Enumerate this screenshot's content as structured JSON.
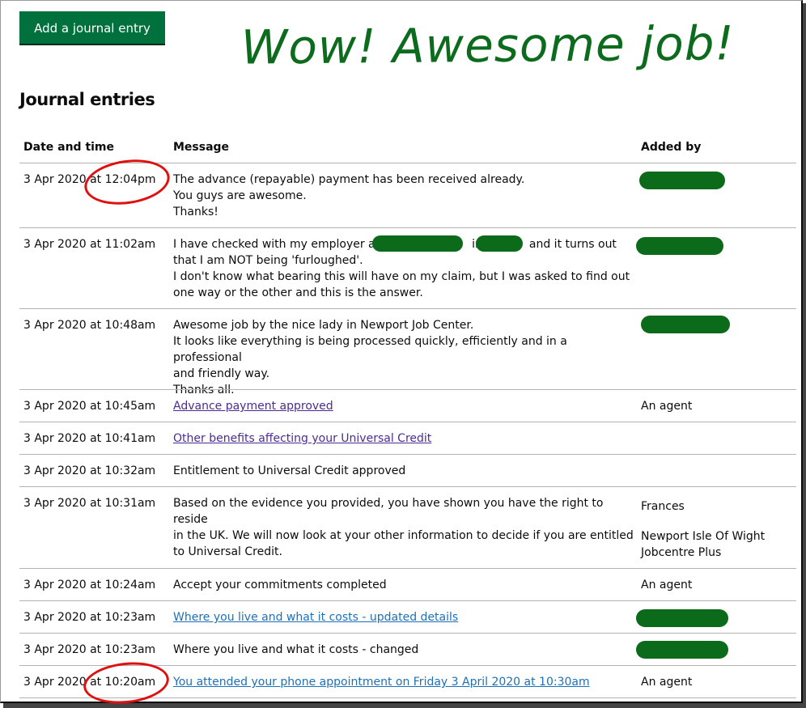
{
  "add_button_label": "Add a journal entry",
  "annotation_text": "Wow! Awesome job!",
  "page_title": "Journal entries",
  "table": {
    "headers": {
      "date": "Date and time",
      "message": "Message",
      "added_by": "Added by"
    },
    "rows": [
      {
        "date": "3 Apr 2020 at 12:04pm",
        "lines": [
          "The advance (repayable) payment has been received already.",
          "You guys are awesome.",
          "Thanks!"
        ],
        "added_by": ""
      },
      {
        "date": "3 Apr 2020 at 11:02am",
        "line1_a": "I have checked with my employer at",
        "line1_b": "in",
        "line1_c": "and it turns out",
        "lines_rest": [
          "that I am NOT being 'furloughed'.",
          "I don't know what bearing this will have on my claim, but I was asked to find out",
          "one way or the other and this is the answer."
        ],
        "added_by": ""
      },
      {
        "date": "3 Apr 2020 at 10:48am",
        "lines": [
          "Awesome job by the nice lady in Newport Job Center.",
          "It looks like everything is being processed quickly, efficiently and in a professional",
          "and friendly way.",
          "Thanks all."
        ],
        "added_by": ""
      },
      {
        "date": "3 Apr 2020 at 10:45am",
        "link": "Advance payment approved",
        "added_by": "An agent"
      },
      {
        "date": "3 Apr 2020 at 10:41am",
        "link": "Other benefits affecting your Universal Credit",
        "added_by": ""
      },
      {
        "date": "3 Apr 2020 at 10:32am",
        "message": "Entitlement to Universal Credit approved",
        "added_by": ""
      },
      {
        "date": "3 Apr 2020 at 10:31am",
        "lines": [
          "Based on the evidence you provided, you have shown you have the right to reside",
          "in the UK. We will now look at your other information to decide if you are entitled",
          "to Universal Credit."
        ],
        "added_by_name": "Frances",
        "added_by_office_lines": [
          "Newport Isle Of Wight",
          "Jobcentre Plus"
        ]
      },
      {
        "date": "3 Apr 2020 at 10:24am",
        "message": "Accept your commitments completed",
        "added_by": "An agent"
      },
      {
        "date": "3 Apr 2020 at 10:23am",
        "link": "Where you live and what it costs - updated details",
        "added_by": ""
      },
      {
        "date": "3 Apr 2020 at 10:23am",
        "message": "Where you live and what it costs - changed",
        "added_by": ""
      },
      {
        "date": "3 Apr 2020 at 10:20am",
        "link": "You attended your phone appointment on Friday 3 April 2020 at 10:30am",
        "added_by": "An agent"
      }
    ]
  }
}
